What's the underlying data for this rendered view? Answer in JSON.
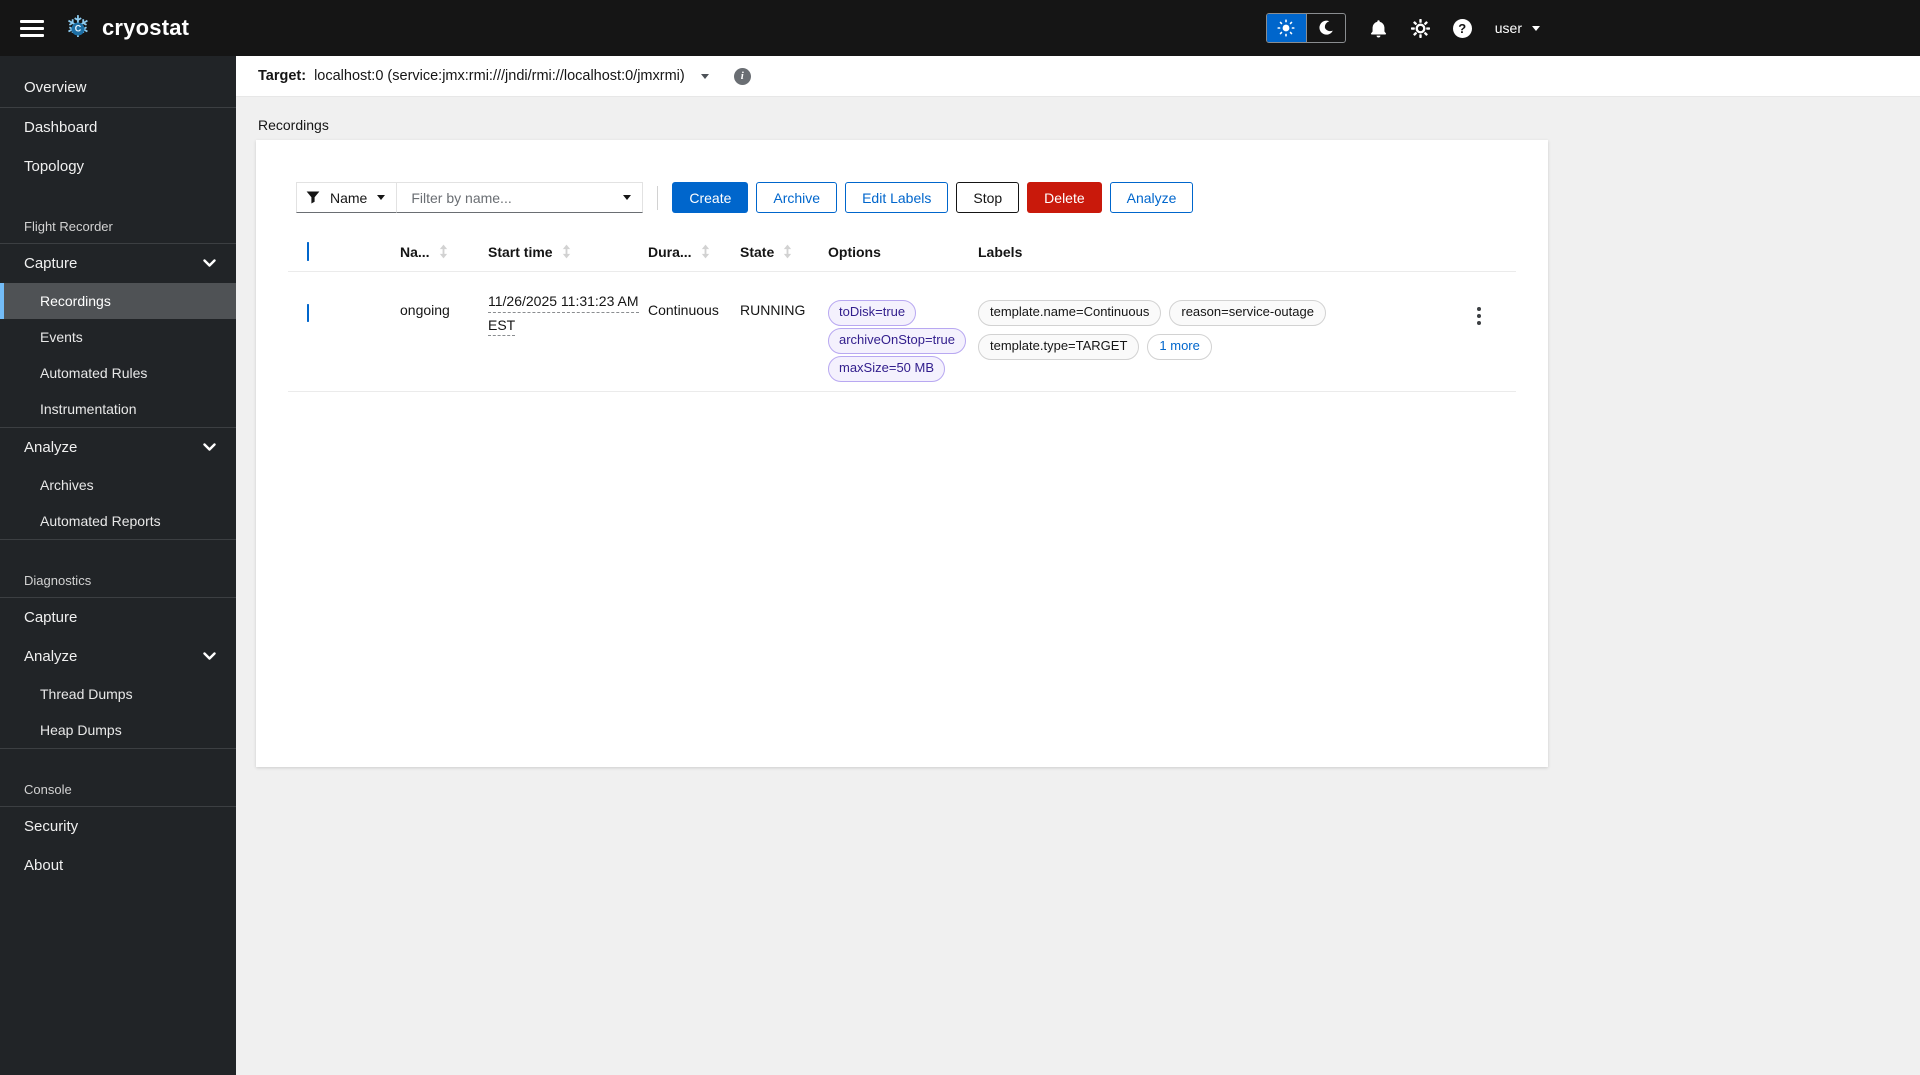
{
  "masthead": {
    "brand": "cryostat",
    "logo_letter": "C",
    "user": "user",
    "help_glyph": "?"
  },
  "sidebar": {
    "items": [
      {
        "label": "Overview"
      },
      {
        "label": "Dashboard"
      },
      {
        "label": "Topology"
      },
      {
        "label": "Flight Recorder"
      },
      {
        "label": "Capture"
      },
      {
        "label": "Recordings",
        "active": true
      },
      {
        "label": "Events"
      },
      {
        "label": "Automated Rules"
      },
      {
        "label": "Instrumentation"
      },
      {
        "label": "Analyze"
      },
      {
        "label": "Archives"
      },
      {
        "label": "Automated Reports"
      },
      {
        "label": "Diagnostics"
      },
      {
        "label": "Capture"
      },
      {
        "label": "Analyze"
      },
      {
        "label": "Thread Dumps"
      },
      {
        "label": "Heap Dumps"
      },
      {
        "label": "Console"
      },
      {
        "label": "Security"
      },
      {
        "label": "About"
      }
    ]
  },
  "target_bar": {
    "label": "Target:",
    "value": "localhost:0 (service:jmx:rmi:///jndi/rmi://localhost:0/jmxrmi)",
    "info_glyph": "i"
  },
  "page": {
    "title": "Recordings"
  },
  "toolbar": {
    "filter_attribute": "Name",
    "filter_placeholder": "Filter by name...",
    "create_label": "Create",
    "archive_label": "Archive",
    "edit_labels_label": "Edit Labels",
    "stop_label": "Stop",
    "delete_label": "Delete",
    "analyze_label": "Analyze"
  },
  "table": {
    "columns": {
      "name": "Na...",
      "start_time": "Start time",
      "duration": "Dura...",
      "state": "State",
      "options": "Options",
      "labels": "Labels"
    },
    "row": {
      "name": "ongoing",
      "start_date": "11/26/2025 11:31:23 AM",
      "start_tz": "EST",
      "duration": "Continuous",
      "state": "RUNNING",
      "options": [
        "toDisk=true",
        "archiveOnStop=true",
        "maxSize=50 MB"
      ],
      "labels": [
        "template.name=Continuous",
        "reason=service-outage",
        "template.type=TARGET"
      ],
      "more": "1 more"
    }
  },
  "colors": {
    "primary": "#0066cc",
    "danger": "#c9190b",
    "masthead_bg": "#151515",
    "sidebar_bg": "#212427",
    "active_nav_bg": "#4f5255",
    "active_nav_border": "#73bcf7",
    "content_bg": "#f0f0f0",
    "option_chip_bg": "#f4f1fd",
    "option_chip_border": "#b8a8f1",
    "option_chip_text": "#311d8c"
  }
}
